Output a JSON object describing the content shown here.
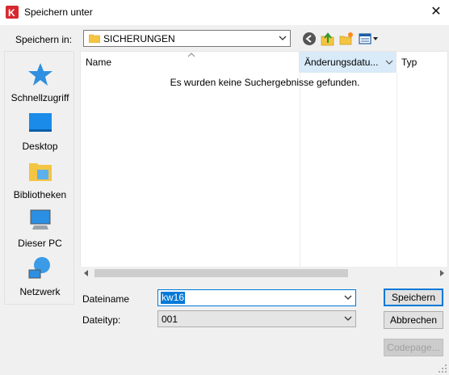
{
  "window": {
    "title": "Speichern unter",
    "close_symbol": "✕"
  },
  "location": {
    "label": "Speichern in:",
    "value": "SICHERUNGEN"
  },
  "toolbar": {
    "icons": [
      "back-icon",
      "up-folder-icon",
      "new-folder-icon",
      "view-menu-icon"
    ]
  },
  "places": [
    {
      "id": "quick",
      "label": "Schnellzugriff",
      "icon": "star-icon"
    },
    {
      "id": "desktop",
      "label": "Desktop",
      "icon": "desktop-icon"
    },
    {
      "id": "libraries",
      "label": "Bibliotheken",
      "icon": "libraries-icon"
    },
    {
      "id": "pc",
      "label": "Dieser PC",
      "icon": "computer-icon"
    },
    {
      "id": "network",
      "label": "Netzwerk",
      "icon": "network-icon"
    }
  ],
  "filelist": {
    "columns": [
      "Name",
      "Änderungsdatu...",
      "Typ"
    ],
    "sorted_column": "Änderungsdatu...",
    "empty_message": "Es wurden keine Suchergebnisse gefunden."
  },
  "filename": {
    "label": "Dateiname",
    "value": "kw16"
  },
  "filetype": {
    "label": "Dateityp:",
    "value": "001"
  },
  "buttons": {
    "save": "Speichern",
    "cancel": "Abbrechen",
    "codepage": "Codepage..."
  },
  "colors": {
    "accent": "#0078d7",
    "selection": "#cce8ff",
    "sorted_header": "#d9ebf9",
    "app_red": "#d8282f"
  }
}
